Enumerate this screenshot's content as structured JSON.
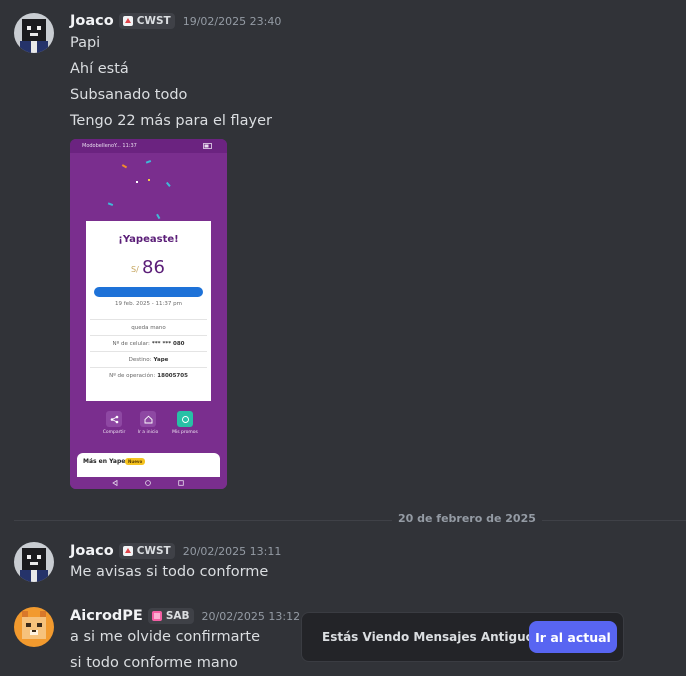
{
  "messages": [
    {
      "author": "Joaco",
      "tag": "CWST",
      "timestamp": "19/02/2025 23:40",
      "lines": [
        "Papi",
        "Ahí está",
        "Subsanado todo",
        "Tengo 22 más para el flayer"
      ]
    },
    {
      "author": "Joaco",
      "tag": "CWST",
      "timestamp": "20/02/2025 13:11",
      "lines": [
        "Me avisas si todo conforme"
      ]
    },
    {
      "author": "AicrodPE",
      "tag": "SAB",
      "timestamp": "20/02/2025 13:12",
      "lines": [
        "a si me olvide confirmarte",
        "si todo conforme mano"
      ]
    }
  ],
  "attachment": {
    "status_left": "ModobelIenoY... 11:37",
    "title": "¡Yapeaste!",
    "currency": "S/",
    "amount": "86",
    "datetime": "19 feb. 2025 - 11:37 pm",
    "rows": [
      {
        "label": "queda mano",
        "value": ""
      },
      {
        "label": "Nº de celular:",
        "value": "*** *** 080"
      },
      {
        "label": "Destino:",
        "value": "Yape"
      },
      {
        "label": "Nº de operación:",
        "value": "18005705"
      }
    ],
    "actions": [
      "Compartir",
      "Ir a inicio",
      "Mis promos"
    ],
    "more_title": "Más en Yape",
    "more_badge": "Nuevo"
  },
  "divider_label": "20 de febrero de 2025",
  "banner": {
    "text": "Estás Viendo Mensajes Antiguos",
    "button": "Ir al actual"
  },
  "colors": {
    "background": "#313338",
    "accent": "#5865f2",
    "yape_purple": "#7a2e8e"
  }
}
